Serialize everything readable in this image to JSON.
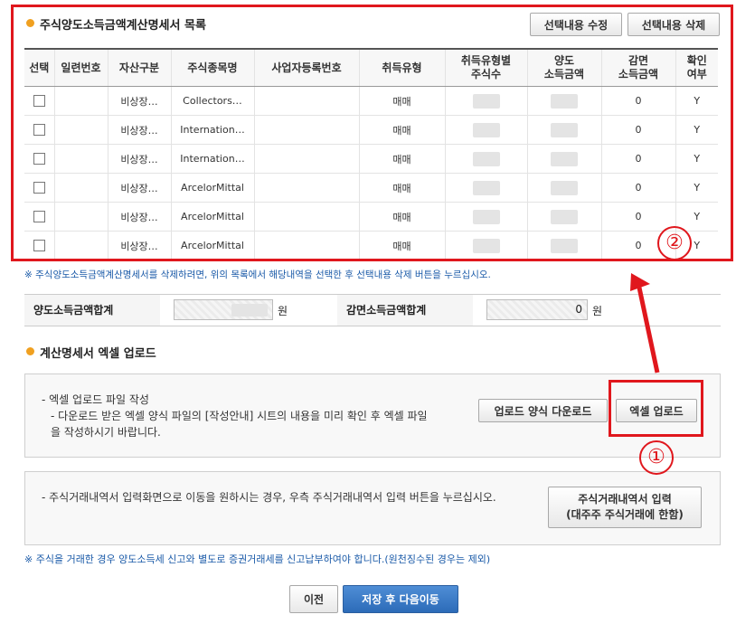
{
  "list_section": {
    "title": "주식양도소득금액계산명세서 목록",
    "edit_button": "선택내용 수정",
    "delete_button": "선택내용 삭제",
    "columns": {
      "select": "선택",
      "serial": "일련번호",
      "asset_type": "자산구분",
      "stock_name": "주식종목명",
      "biz_reg_no": "사업자등록번호",
      "acq_type": "취득유형",
      "acq_shares_1": "취득유형별",
      "acq_shares_2": "주식수",
      "transfer_1": "양도",
      "transfer_2": "소득금액",
      "reduction_1": "감면",
      "reduction_2": "소득금액",
      "confirm_1": "확인",
      "confirm_2": "여부"
    },
    "rows": [
      {
        "asset_type": "비상장…",
        "stock_name": "Collectors…",
        "acq_type": "매매",
        "reduction": "0",
        "confirm": "Y"
      },
      {
        "asset_type": "비상장…",
        "stock_name": "Internation…",
        "acq_type": "매매",
        "reduction": "0",
        "confirm": "Y"
      },
      {
        "asset_type": "비상장…",
        "stock_name": "Internation…",
        "acq_type": "매매",
        "reduction": "0",
        "confirm": "Y"
      },
      {
        "asset_type": "비상장…",
        "stock_name": "ArcelorMittal",
        "acq_type": "매매",
        "reduction": "0",
        "confirm": "Y"
      },
      {
        "asset_type": "비상장…",
        "stock_name": "ArcelorMittal",
        "acq_type": "매매",
        "reduction": "0",
        "confirm": "Y"
      },
      {
        "asset_type": "비상장…",
        "stock_name": "ArcelorMittal",
        "acq_type": "매매",
        "reduction": "0",
        "confirm": "Y"
      }
    ],
    "delete_note": "※ 주식양도소득금액계산명세서를 삭제하려면, 위의 목록에서 해당내역을 선택한 후 선택내용 삭제 버튼을 누르십시오."
  },
  "summary": {
    "transfer_total_label": "양도소득금액합계",
    "transfer_unit": "원",
    "reduction_total_label": "감면소득금액합계",
    "reduction_total_value": "0",
    "reduction_unit": "원"
  },
  "upload_section": {
    "title": "계산명세서 엑셀 업로드",
    "line1": "- 엑셀 업로드 파일 작성",
    "line2": "- 다운로드 받은 엑셀 양식 파일의 [작성안내] 시트의 내용을 미리 확인 후 엑셀 파일",
    "line3": "을 작성하시기 바랍니다.",
    "download_button": "업로드 양식 다운로드",
    "upload_button": "엑셀 업로드"
  },
  "trade_section": {
    "text": "- 주식거래내역서 입력화면으로 이동을 원하시는 경우, 우측 주식거래내역서 입력 버튼을 누르십시오.",
    "button_line1": "주식거래내역서 입력",
    "button_line2": "(대주주 주식거래에 한함)"
  },
  "footer_note": "※ 주식을 거래한 경우 양도소득세 신고와 별도로 증권거래세를 신고납부하여야 합니다.(원천징수된 경우는 제외)",
  "nav": {
    "prev_button": "이전",
    "next_button": "저장 후 다음이동"
  },
  "annotations": {
    "marker_1": "①",
    "marker_2": "②",
    "color": "#e0171d"
  }
}
